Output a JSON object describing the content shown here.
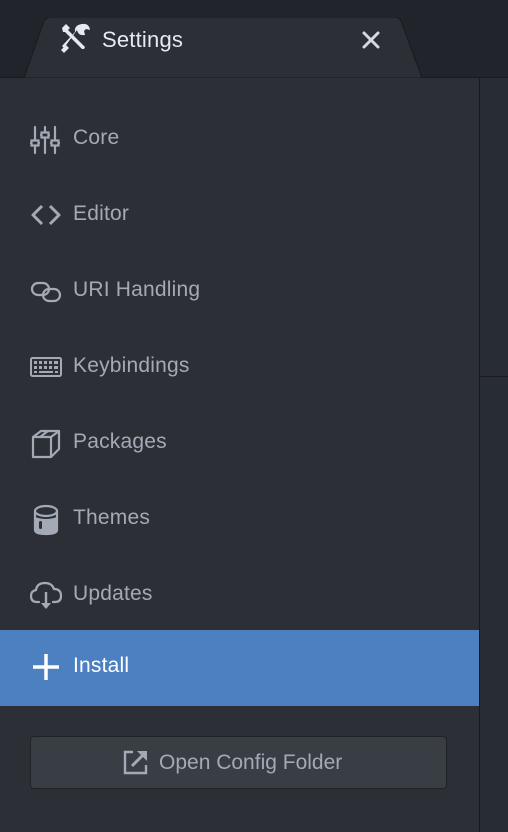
{
  "tab": {
    "title": "Settings",
    "icon": "tools-icon",
    "close_icon": "close-icon"
  },
  "sidebar": {
    "items": [
      {
        "label": "Core",
        "icon": "sliders-icon"
      },
      {
        "label": "Editor",
        "icon": "code-icon"
      },
      {
        "label": "URI Handling",
        "icon": "link-icon"
      },
      {
        "label": "Keybindings",
        "icon": "keyboard-icon"
      },
      {
        "label": "Packages",
        "icon": "package-icon"
      },
      {
        "label": "Themes",
        "icon": "paintcan-icon"
      },
      {
        "label": "Updates",
        "icon": "cloud-download-icon"
      },
      {
        "label": "Install",
        "icon": "plus-icon",
        "active": true
      }
    ],
    "config_button": {
      "label": "Open Config Folder",
      "icon": "link-external-icon"
    }
  },
  "colors": {
    "background": "#21252b",
    "sidebar": "#2c3036",
    "active": "#4d80c1",
    "text": "#a3aab6",
    "active_text": "#ffffff"
  }
}
